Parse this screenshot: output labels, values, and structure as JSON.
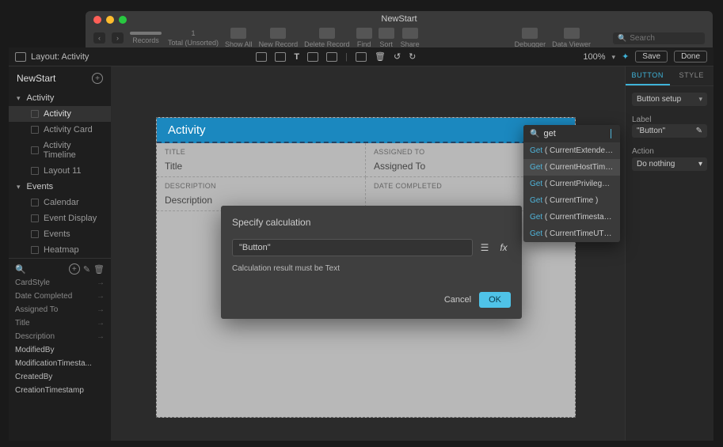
{
  "chrome": {
    "title": "NewStart",
    "records_label": "Records",
    "total_label": "Total (Unsorted)",
    "total_count": "1",
    "tools": [
      "Show All",
      "New Record",
      "Delete Record",
      "Find",
      "Sort",
      "Share",
      "Debugger",
      "Data Viewer"
    ],
    "search_placeholder": "Search"
  },
  "toolbar": {
    "layout_label": "Layout: Activity",
    "zoom": "100%",
    "save": "Save",
    "done": "Done"
  },
  "sidebar": {
    "project": "NewStart",
    "sections": [
      {
        "name": "Activity",
        "items": [
          "Activity",
          "Activity Card",
          "Activity Timeline",
          "Layout 11"
        ]
      },
      {
        "name": "Events",
        "items": [
          "Calendar",
          "Event Display",
          "Events",
          "Heatmap"
        ]
      }
    ],
    "fields": [
      "CardStyle",
      "Date Completed",
      "Assigned To",
      "Title",
      "Description",
      "ModifiedBy",
      "ModificationTimesta...",
      "CreatedBy",
      "CreationTimestamp"
    ]
  },
  "layout": {
    "title": "Activity",
    "cells": [
      {
        "label": "TITLE",
        "value": "Title"
      },
      {
        "label": "ASSIGNED TO",
        "value": "Assigned To"
      },
      {
        "label": "DESCRIPTION",
        "value": "Description"
      },
      {
        "label": "DATE COMPLETED",
        "value": ""
      }
    ]
  },
  "modal": {
    "title": "Specify calculation",
    "input": "\"Button\"",
    "hint": "Calculation result must be Text",
    "cancel": "Cancel",
    "ok": "OK"
  },
  "autocomplete": {
    "query": "get",
    "items": [
      "( CurrentExtendedPriv...",
      "( CurrentHostTimesta...",
      "( CurrentPrivilegeSetN...",
      "( CurrentTime )",
      "( CurrentTimestamp )",
      "( CurrentTimeUTCMilli..."
    ],
    "keyword": "Get",
    "selected_index": 1
  },
  "inspector": {
    "tabs": [
      "BUTTON",
      "STYLE"
    ],
    "setup_label": "Button setup",
    "label_label": "Label",
    "label_value": "\"Button\"",
    "action_label": "Action",
    "action_value": "Do nothing"
  }
}
